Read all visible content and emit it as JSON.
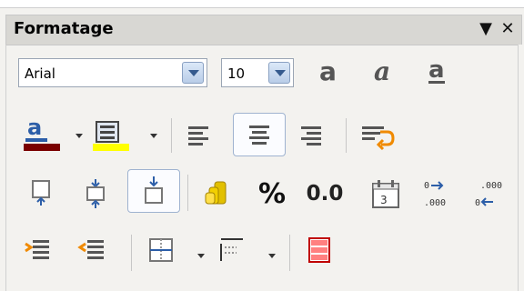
{
  "panel": {
    "title": "Formatage",
    "menu_icon": "dropdown-arrow-icon",
    "close_icon": "close-icon"
  },
  "font": {
    "name": "Arial",
    "size": "10"
  },
  "toolbar": {
    "row1": [
      "bold-a-icon",
      "italic-a-icon",
      "underline-a-icon"
    ],
    "row2": [
      "font-color-icon",
      "highlight-icon",
      "align-left-icon",
      "align-center-icon",
      "align-right-icon",
      "wrap-text-icon"
    ],
    "row3": [
      "align-top-icon",
      "align-center-vertical-icon",
      "align-bottom-icon",
      "currency-icon",
      "percent-icon",
      "decimal-icon",
      "date-icon",
      "add-decimal-icon",
      "remove-decimal-icon"
    ],
    "row3_text": {
      "percent": "%",
      "decimal": "0.0"
    },
    "row4": [
      "increase-indent-icon",
      "decrease-indent-icon",
      "borders-icon",
      "border-style-icon",
      "conditional-format-icon"
    ]
  },
  "colors": {
    "font_color_bar": "#7a0000",
    "highlight_bar": "#ffff00",
    "icon_blue": "#2c5ea8"
  }
}
